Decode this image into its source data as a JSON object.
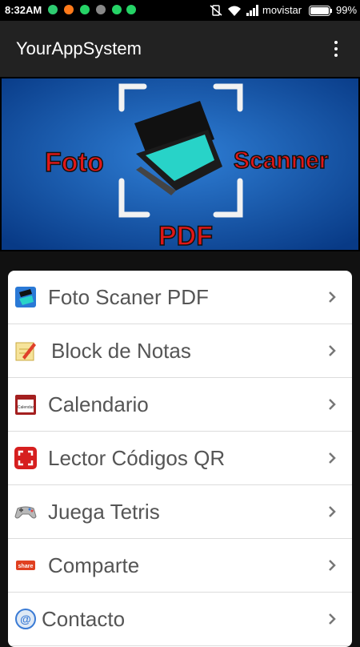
{
  "status": {
    "time": "8:32AM",
    "carrier": "movistar",
    "battery": "99%"
  },
  "appbar": {
    "title": "YourAppSystem"
  },
  "banner": {
    "word_left": "Foto",
    "word_right": "Scanner",
    "word_bottom": "PDF"
  },
  "menu": {
    "items": [
      {
        "label": "Foto Scaner PDF",
        "icon": "scanner-icon"
      },
      {
        "label": "Block de Notas",
        "icon": "notepad-icon"
      },
      {
        "label": "Calendario",
        "icon": "calendar-icon",
        "icon_text": "Calendar"
      },
      {
        "label": "Lector Códigos QR",
        "icon": "qr-scanner-icon"
      },
      {
        "label": "Juega Tetris",
        "icon": "gamepad-icon"
      },
      {
        "label": "Comparte",
        "icon": "share-icon",
        "icon_text": "share"
      },
      {
        "label": "Contacto",
        "icon": "contact-icon"
      }
    ]
  },
  "colors": {
    "appbar": "#222222",
    "banner_blue": "#0d4ea0",
    "accent_red": "#e01818",
    "label_gray": "#555555"
  }
}
